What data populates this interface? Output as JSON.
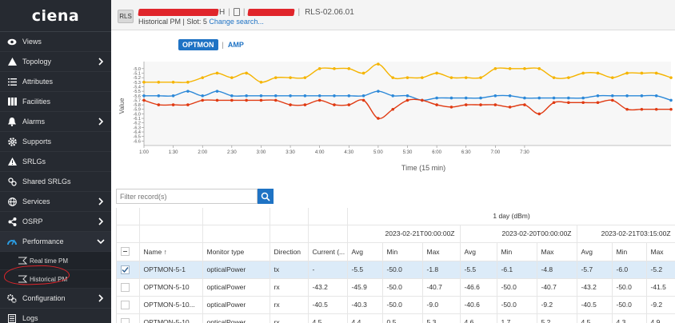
{
  "brand": "ciena",
  "sidebar": {
    "items": [
      {
        "label": "Views",
        "icon": "eye-icon",
        "chevron": false
      },
      {
        "label": "Topology",
        "icon": "topology-icon",
        "chevron": true
      },
      {
        "label": "Attributes",
        "icon": "list-icon",
        "chevron": false
      },
      {
        "label": "Facilities",
        "icon": "facilities-icon",
        "chevron": false
      },
      {
        "label": "Alarms",
        "icon": "bell-icon",
        "chevron": true
      },
      {
        "label": "Supports",
        "icon": "gear-icon",
        "chevron": false
      },
      {
        "label": "SRLGs",
        "icon": "warning-icon",
        "chevron": false
      },
      {
        "label": "Shared SRLGs",
        "icon": "shared-icon",
        "chevron": false
      },
      {
        "label": "Services",
        "icon": "globe-icon",
        "chevron": true
      },
      {
        "label": "OSRP",
        "icon": "share-icon",
        "chevron": true
      },
      {
        "label": "Performance",
        "icon": "performance-icon",
        "chevron": true,
        "expanded": true
      }
    ],
    "performance_sub": [
      {
        "label": "Real time PM"
      },
      {
        "label": "Historical PM",
        "selected": true
      }
    ],
    "bottom_items": [
      {
        "label": "Configuration",
        "icon": "config-icon",
        "chevron": true
      },
      {
        "label": "Logs",
        "icon": "logs-icon",
        "chevron": false
      }
    ]
  },
  "header": {
    "badge": "RLS",
    "top_suffix_1": "H",
    "version": "RLS-02.06.01",
    "page": "Historical PM",
    "slot_prefix": "| Slot: 5 ",
    "change_link": "Change search..."
  },
  "tabs": {
    "active": "OPTMON",
    "sep": "|",
    "other": "AMP"
  },
  "colors": {
    "accent": "#1f73c4",
    "series1": "#f5b400",
    "series2": "#2b88d8",
    "series3": "#e03a12"
  },
  "chart_data": {
    "type": "line",
    "ylabel": "Value",
    "xlabel": "Time (15 min)",
    "x_ticks": [
      "1:00",
      "1:30",
      "2:00",
      "2:30",
      "3:00",
      "3:30",
      "4:00",
      "4:30",
      "5:00",
      "5:30",
      "6:00",
      "6:30",
      "7:00",
      "7:30"
    ],
    "y_ticks": [
      "-5.0",
      "-5.1",
      "-5.2",
      "-5.3",
      "-5.4",
      "-5.5",
      "-5.6",
      "-5.7",
      "-5.8",
      "-5.9",
      "-6.0",
      "-6.1",
      "-6.2",
      "-6.3",
      "-6.4",
      "-6.5",
      "-6.6"
    ],
    "ylim": [
      -6.7,
      -4.95
    ],
    "x_start_min": 60,
    "step_min": 15,
    "series": [
      {
        "values": [
          -5.3,
          -5.3,
          -5.3,
          -5.3,
          -5.2,
          -5.1,
          -5.2,
          -5.1,
          -5.3,
          -5.2,
          -5.2,
          -5.2,
          -5.0,
          -5.0,
          -5.0,
          -5.1,
          -4.9,
          -5.2,
          -5.2,
          -5.2,
          -5.1,
          -5.2,
          -5.2,
          -5.2,
          -5.0,
          -5.0,
          -5.0,
          -5.0,
          -5.2,
          -5.2,
          -5.1,
          -5.1,
          -5.2,
          -5.1,
          -5.1,
          -5.1,
          -5.2
        ]
      },
      {
        "values": [
          -5.6,
          -5.6,
          -5.6,
          -5.5,
          -5.6,
          -5.5,
          -5.6,
          -5.6,
          -5.6,
          -5.6,
          -5.6,
          -5.6,
          -5.6,
          -5.6,
          -5.6,
          -5.6,
          -5.5,
          -5.6,
          -5.6,
          -5.7,
          -5.65,
          -5.65,
          -5.65,
          -5.65,
          -5.6,
          -5.6,
          -5.65,
          -5.65,
          -5.65,
          -5.65,
          -5.65,
          -5.6,
          -5.6,
          -5.6,
          -5.6,
          -5.6,
          -5.7
        ]
      },
      {
        "values": [
          -5.7,
          -5.8,
          -5.8,
          -5.8,
          -5.7,
          -5.7,
          -5.7,
          -5.7,
          -5.7,
          -5.7,
          -5.8,
          -5.8,
          -5.7,
          -5.8,
          -5.8,
          -5.7,
          -6.1,
          -5.9,
          -5.7,
          -5.7,
          -5.8,
          -5.85,
          -5.8,
          -5.8,
          -5.8,
          -5.85,
          -5.8,
          -6.0,
          -5.75,
          -5.75,
          -5.75,
          -5.75,
          -5.7,
          -5.9,
          -5.9,
          -5.9,
          -5.9
        ]
      }
    ]
  },
  "filter": {
    "placeholder": "Filter record(s)"
  },
  "table": {
    "group_label": "1 day (dBm)",
    "dates": [
      "2023-02-21T00:00:00Z",
      "2023-02-20T00:00:00Z",
      "2023-02-21T03:15:00Z"
    ],
    "columns": [
      "Name",
      "Monitor type",
      "Direction",
      "Current (...",
      "Avg",
      "Min",
      "Max",
      "Avg",
      "Min",
      "Max",
      "Avg",
      "Min",
      "Max"
    ],
    "sort_arrow": "↑",
    "rows": [
      {
        "selected": true,
        "cells": [
          "OPTMON-5-1",
          "opticalPower",
          "tx",
          "-",
          "-5.5",
          "-50.0",
          "-1.8",
          "-5.5",
          "-6.1",
          "-4.8",
          "-5.7",
          "-6.0",
          "-5.2"
        ]
      },
      {
        "selected": false,
        "cells": [
          "OPTMON-5-10",
          "opticalPower",
          "rx",
          "-43.2",
          "-45.9",
          "-50.0",
          "-40.7",
          "-46.6",
          "-50.0",
          "-40.7",
          "-43.2",
          "-50.0",
          "-41.5"
        ]
      },
      {
        "selected": false,
        "cells": [
          "OPTMON-5-10...",
          "opticalPower",
          "rx",
          "-40.5",
          "-40.3",
          "-50.0",
          "-9.0",
          "-40.6",
          "-50.0",
          "-9.2",
          "-40.5",
          "-50.0",
          "-9.2"
        ]
      },
      {
        "selected": false,
        "cells": [
          "OPTMON-5-10...",
          "opticalPower",
          "rx",
          "4.5",
          "4.4",
          "0.5",
          "5.3",
          "4.6",
          "1.7",
          "5.2",
          "4.5",
          "4.3",
          "4.9"
        ]
      }
    ]
  }
}
